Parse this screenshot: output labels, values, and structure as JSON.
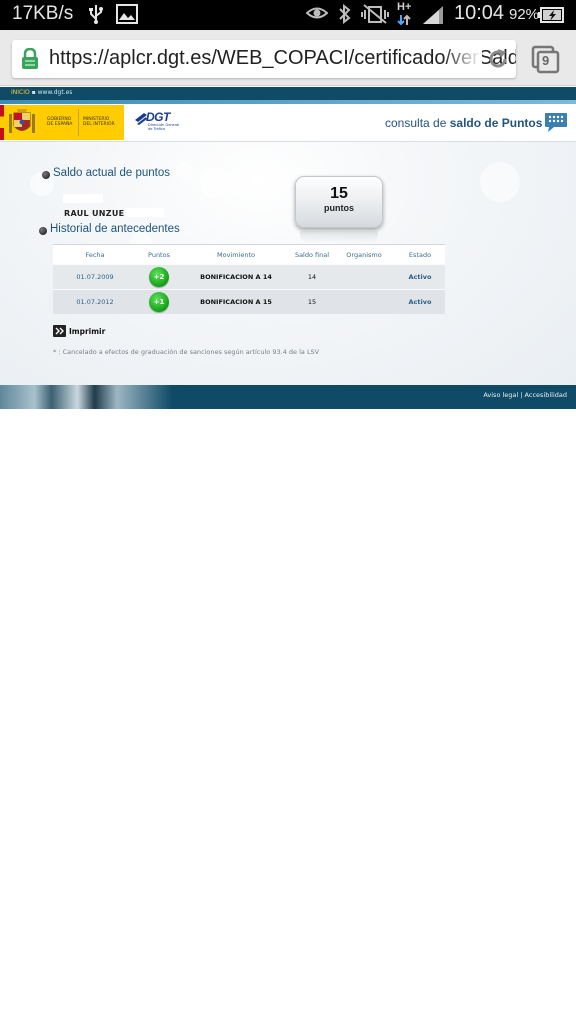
{
  "status_bar": {
    "speed": "17KB/s",
    "network": "H+",
    "time": "10:04",
    "battery": "92%"
  },
  "browser": {
    "url": "https://aplcr.dgt.es/WEB_COPACI/certificado/verSaldo",
    "tab_count": "9"
  },
  "site": {
    "top_links": {
      "inicio": "INICIO",
      "web": "www.dgt.es"
    },
    "gobierno_line1": "GOBIERNO",
    "gobierno_line2": "DE ESPAÑA",
    "ministerio_line1": "MINISTERIO",
    "ministerio_line2": "DEL INTERIOR",
    "dgt_name": "DGT",
    "dgt_sub_line1": "Dirección General",
    "dgt_sub_line2": "de Tráfico",
    "consulta_prefix": "consulta de ",
    "consulta_bold": "saldo de Puntos"
  },
  "saldo": {
    "title": "Saldo actual de puntos",
    "name": "RAUL UNZUE",
    "points": "15",
    "points_label": "puntos"
  },
  "historial": {
    "title": "Historial de antecedentes",
    "columns": [
      "Fecha",
      "Puntos",
      "Movimiento",
      "Saldo final",
      "Organismo",
      "Estado"
    ],
    "rows": [
      {
        "fecha": "01.07.2009",
        "puntos": "+2",
        "movimiento": "BONIFICACION A 14",
        "saldo_final": "14",
        "organismo": "",
        "estado": "Activo"
      },
      {
        "fecha": "01.07.2012",
        "puntos": "+1",
        "movimiento": "BONIFICACION A 15",
        "saldo_final": "15",
        "organismo": "",
        "estado": "Activo"
      }
    ]
  },
  "print_label": "Imprimir",
  "note": "* : Cancelado a efectos de graduación de sanciones según artículo 93.4 de la LSV",
  "footer": {
    "aviso": "Aviso legal",
    "sep": " | ",
    "accesibilidad": "Accesibilidad"
  }
}
